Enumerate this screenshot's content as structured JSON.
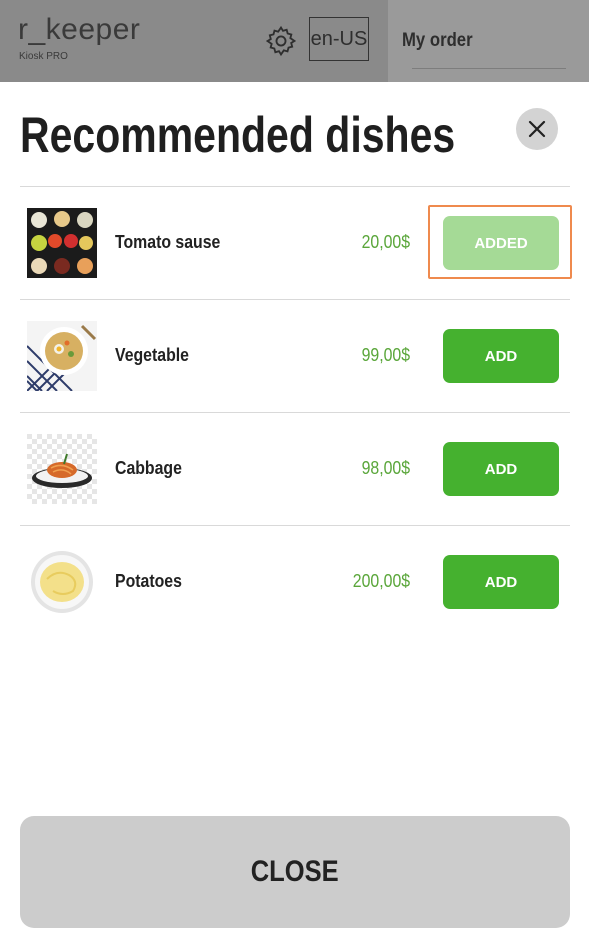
{
  "header": {
    "logo": "r_keeper",
    "logo_sub": "Kiosk PRO",
    "language": "en-US",
    "order_title": "My order"
  },
  "modal": {
    "title": "Recommended dishes",
    "close_label": "CLOSE",
    "dishes": [
      {
        "name": "Tomato sause",
        "price": "20,00$",
        "button": "ADDED"
      },
      {
        "name": "Vegetable",
        "price": "99,00$",
        "button": "ADD"
      },
      {
        "name": "Cabbage",
        "price": "98,00$",
        "button": "ADD"
      },
      {
        "name": "Potatoes",
        "price": "200,00$",
        "button": "ADD"
      }
    ]
  },
  "colors": {
    "accent_green": "#45b12f",
    "added_green": "#a5da96",
    "price_green": "#5aa63a",
    "highlight_orange": "#ef8a4e"
  },
  "icons": [
    "gear-icon",
    "close-icon"
  ]
}
